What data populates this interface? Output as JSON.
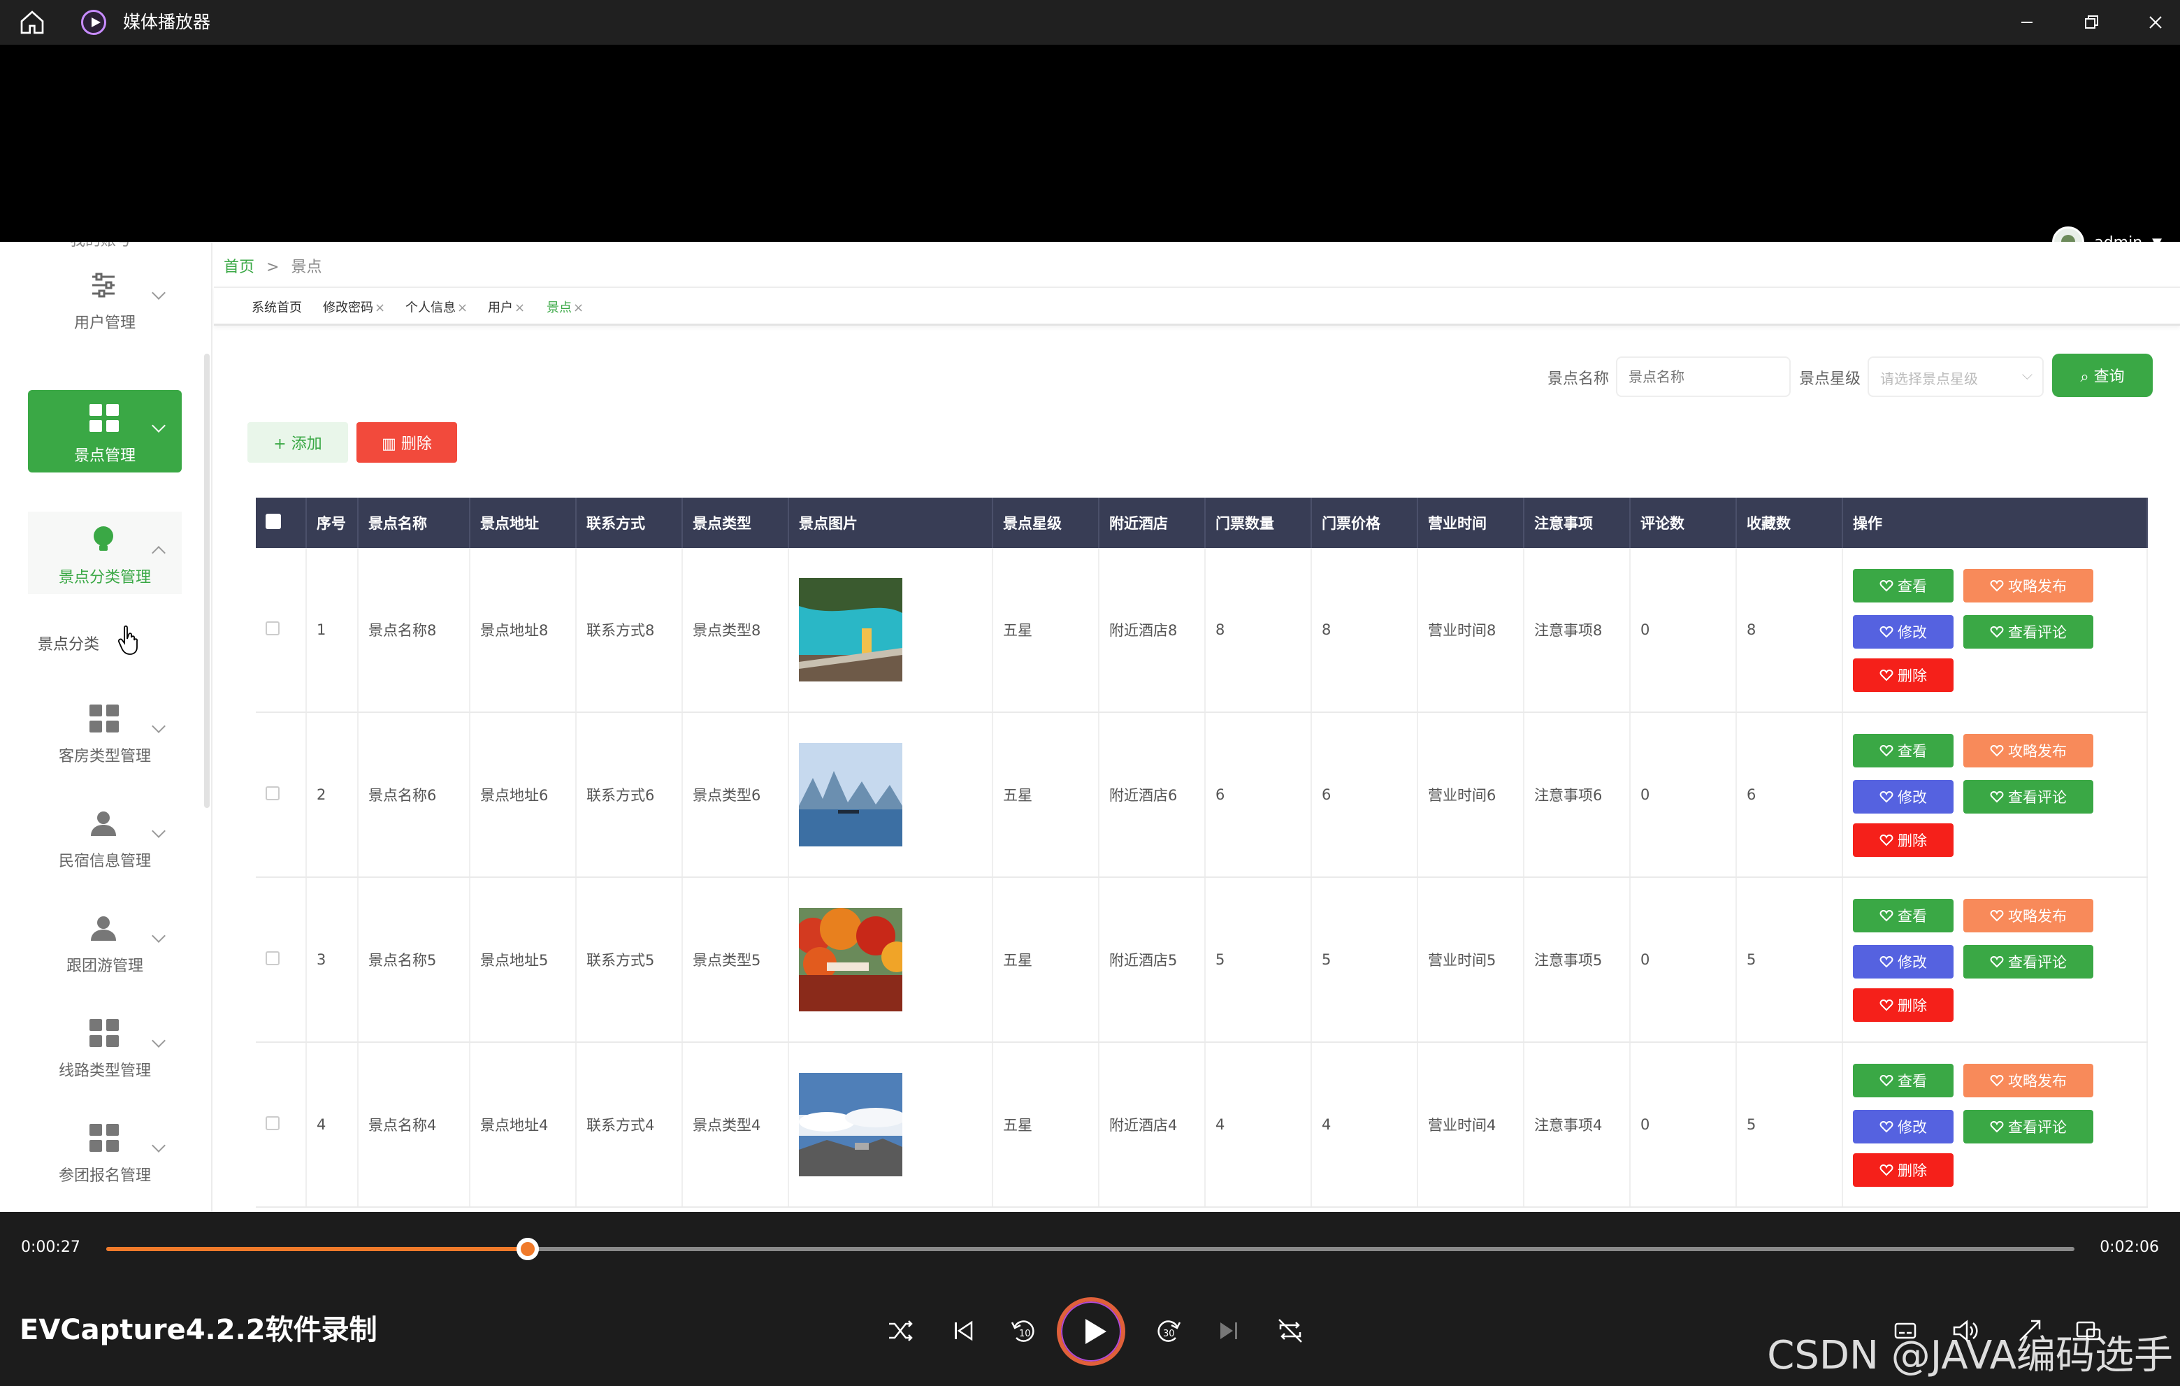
{
  "window": {
    "title": "媒体播放器"
  },
  "header": {
    "username": "admin"
  },
  "sidebar": {
    "cut_label": "我的账号",
    "items": [
      {
        "label": "用户管理",
        "icon": "sliders-icon"
      },
      {
        "label": "景点管理",
        "icon": "grid-icon",
        "active": true
      },
      {
        "label": "景点分类管理",
        "icon": "lightbulb-icon",
        "open": true
      },
      {
        "label": "客房类型管理",
        "icon": "grid-icon"
      },
      {
        "label": "民宿信息管理",
        "icon": "person-icon"
      },
      {
        "label": "跟团游管理",
        "icon": "person-icon"
      },
      {
        "label": "线路类型管理",
        "icon": "grid-icon"
      },
      {
        "label": "参团报名管理",
        "icon": "grid-icon"
      }
    ],
    "sub_item": "景点分类"
  },
  "breadcrumb": {
    "home": "首页",
    "sep": ">",
    "current": "景点"
  },
  "tabs": [
    {
      "label": "系统首页"
    },
    {
      "label": "修改密码"
    },
    {
      "label": "个人信息"
    },
    {
      "label": "用户"
    },
    {
      "label": "景点"
    }
  ],
  "tab_close": "×",
  "search": {
    "name_label": "景点名称",
    "name_placeholder": "景点名称",
    "level_label": "景点星级",
    "level_placeholder": "请选择景点星级",
    "button": "查询"
  },
  "actions": {
    "add": "添加",
    "delete": "删除"
  },
  "table": {
    "columns": [
      "序号",
      "景点名称",
      "景点地址",
      "联系方式",
      "景点类型",
      "景点图片",
      "景点星级",
      "附近酒店",
      "门票数量",
      "门票价格",
      "营业时间",
      "注意事项",
      "评论数",
      "收藏数",
      "操作"
    ],
    "rows": [
      {
        "no": "1",
        "name": "景点名称8",
        "address": "景点地址8",
        "contact": "联系方式8",
        "type": "景点类型8",
        "image": "lake-cliff",
        "level": "五星",
        "hotel": "附近酒店8",
        "qty": "8",
        "price": "8",
        "hours": "营业时间8",
        "notes": "注意事项8",
        "comments": "0",
        "favs": "8"
      },
      {
        "no": "2",
        "name": "景点名称6",
        "address": "景点地址6",
        "contact": "联系方式6",
        "type": "景点类型6",
        "image": "karst-river",
        "level": "五星",
        "hotel": "附近酒店6",
        "qty": "6",
        "price": "6",
        "hours": "营业时间6",
        "notes": "注意事项6",
        "comments": "0",
        "favs": "6"
      },
      {
        "no": "3",
        "name": "景点名称5",
        "address": "景点地址5",
        "contact": "联系方式5",
        "type": "景点类型5",
        "image": "autumn-forest",
        "level": "五星",
        "hotel": "附近酒店5",
        "qty": "5",
        "price": "5",
        "hours": "营业时间5",
        "notes": "注意事项5",
        "comments": "0",
        "favs": "5"
      },
      {
        "no": "4",
        "name": "景点名称4",
        "address": "景点地址4",
        "contact": "联系方式4",
        "type": "景点类型4",
        "image": "mountain-clouds",
        "level": "五星",
        "hotel": "附近酒店4",
        "qty": "4",
        "price": "4",
        "hours": "营业时间4",
        "notes": "注意事项4",
        "comments": "0",
        "favs": "5"
      }
    ],
    "row_buttons": {
      "view": "查看",
      "guide": "攻略发布",
      "edit": "修改",
      "comments": "查看评论",
      "delete": "删除"
    }
  },
  "player": {
    "current_time": "0:00:27",
    "total_time": "0:02:06",
    "progress": 0.214,
    "recording_label": "EVCapture4.2.2软件录制",
    "watermark": "CSDN @JAVA编码选手"
  },
  "colors": {
    "green": "#3aa845",
    "orange": "#f88a5a",
    "blue": "#5562e0",
    "red": "#f5201a",
    "table_header": "#383d55"
  }
}
